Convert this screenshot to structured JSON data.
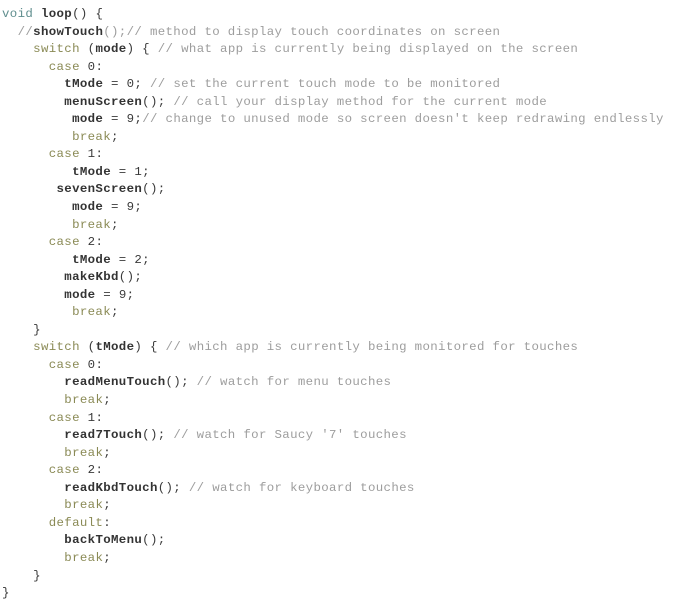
{
  "document": {
    "kind": "source-code-listing",
    "language": "Arduino C++",
    "background_color": "#ffffff",
    "theme": {
      "type_color": "#5f8e8e",
      "keyword_color": "#8a8a55",
      "function_color": "#333333",
      "comment_color": "#9d9d9d",
      "plain_color": "#3a3a3a"
    }
  },
  "code": {
    "lines": [
      {
        "indent": "",
        "tokens": [
          {
            "t": "type",
            "v": "void"
          },
          {
            "t": "plain",
            "v": " "
          },
          {
            "t": "func",
            "v": "loop"
          },
          {
            "t": "punct",
            "v": "() {"
          }
        ]
      },
      {
        "indent": "  ",
        "tokens": [
          {
            "t": "comment",
            "v": "//"
          },
          {
            "t": "func",
            "v": "showTouch"
          },
          {
            "t": "comment",
            "v": "();// method to display touch coordinates on screen"
          }
        ]
      },
      {
        "indent": "    ",
        "tokens": [
          {
            "t": "keyword",
            "v": "switch"
          },
          {
            "t": "plain",
            "v": " ("
          },
          {
            "t": "func",
            "v": "mode"
          },
          {
            "t": "plain",
            "v": ") { "
          },
          {
            "t": "comment",
            "v": "// what app is currently being displayed on the screen"
          }
        ]
      },
      {
        "indent": "      ",
        "tokens": [
          {
            "t": "keyword",
            "v": "case"
          },
          {
            "t": "plain",
            "v": " "
          },
          {
            "t": "number",
            "v": "0"
          },
          {
            "t": "punct",
            "v": ":"
          }
        ]
      },
      {
        "indent": "        ",
        "tokens": [
          {
            "t": "func",
            "v": "tMode"
          },
          {
            "t": "plain",
            "v": " = "
          },
          {
            "t": "number",
            "v": "0"
          },
          {
            "t": "punct",
            "v": "; "
          },
          {
            "t": "comment",
            "v": "// set the current touch mode to be monitored"
          }
        ]
      },
      {
        "indent": "        ",
        "tokens": [
          {
            "t": "func",
            "v": "menuScreen"
          },
          {
            "t": "punct",
            "v": "(); "
          },
          {
            "t": "comment",
            "v": "// call your display method for the current mode"
          }
        ]
      },
      {
        "indent": "         ",
        "tokens": [
          {
            "t": "func",
            "v": "mode"
          },
          {
            "t": "plain",
            "v": " = "
          },
          {
            "t": "number",
            "v": "9"
          },
          {
            "t": "punct",
            "v": ";"
          },
          {
            "t": "comment",
            "v": "// change to unused mode so screen doesn't keep redrawing endlessly"
          }
        ]
      },
      {
        "indent": "         ",
        "tokens": [
          {
            "t": "keyword",
            "v": "break"
          },
          {
            "t": "punct",
            "v": ";"
          }
        ]
      },
      {
        "indent": "      ",
        "tokens": [
          {
            "t": "keyword",
            "v": "case"
          },
          {
            "t": "plain",
            "v": " "
          },
          {
            "t": "number",
            "v": "1"
          },
          {
            "t": "punct",
            "v": ":"
          }
        ]
      },
      {
        "indent": "         ",
        "tokens": [
          {
            "t": "func",
            "v": "tMode"
          },
          {
            "t": "plain",
            "v": " = "
          },
          {
            "t": "number",
            "v": "1"
          },
          {
            "t": "punct",
            "v": ";"
          }
        ]
      },
      {
        "indent": "       ",
        "tokens": [
          {
            "t": "func",
            "v": "sevenScreen"
          },
          {
            "t": "punct",
            "v": "();"
          }
        ]
      },
      {
        "indent": "         ",
        "tokens": [
          {
            "t": "func",
            "v": "mode"
          },
          {
            "t": "plain",
            "v": " = "
          },
          {
            "t": "number",
            "v": "9"
          },
          {
            "t": "punct",
            "v": ";"
          }
        ]
      },
      {
        "indent": "         ",
        "tokens": [
          {
            "t": "keyword",
            "v": "break"
          },
          {
            "t": "punct",
            "v": ";"
          }
        ]
      },
      {
        "indent": "      ",
        "tokens": [
          {
            "t": "keyword",
            "v": "case"
          },
          {
            "t": "plain",
            "v": " "
          },
          {
            "t": "number",
            "v": "2"
          },
          {
            "t": "punct",
            "v": ":"
          }
        ]
      },
      {
        "indent": "         ",
        "tokens": [
          {
            "t": "func",
            "v": "tMode"
          },
          {
            "t": "plain",
            "v": " = "
          },
          {
            "t": "number",
            "v": "2"
          },
          {
            "t": "punct",
            "v": ";"
          }
        ]
      },
      {
        "indent": "        ",
        "tokens": [
          {
            "t": "func",
            "v": "makeKbd"
          },
          {
            "t": "punct",
            "v": "();"
          }
        ]
      },
      {
        "indent": "        ",
        "tokens": [
          {
            "t": "func",
            "v": "mode"
          },
          {
            "t": "plain",
            "v": " = "
          },
          {
            "t": "number",
            "v": "9"
          },
          {
            "t": "punct",
            "v": ";"
          }
        ]
      },
      {
        "indent": "         ",
        "tokens": [
          {
            "t": "keyword",
            "v": "break"
          },
          {
            "t": "punct",
            "v": ";"
          }
        ]
      },
      {
        "indent": "    ",
        "tokens": [
          {
            "t": "punct",
            "v": "}"
          }
        ]
      },
      {
        "indent": "    ",
        "tokens": [
          {
            "t": "keyword",
            "v": "switch"
          },
          {
            "t": "plain",
            "v": " ("
          },
          {
            "t": "func",
            "v": "tMode"
          },
          {
            "t": "plain",
            "v": ") { "
          },
          {
            "t": "comment",
            "v": "// which app is currently being monitored for touches"
          }
        ]
      },
      {
        "indent": "      ",
        "tokens": [
          {
            "t": "keyword",
            "v": "case"
          },
          {
            "t": "plain",
            "v": " "
          },
          {
            "t": "number",
            "v": "0"
          },
          {
            "t": "punct",
            "v": ":"
          }
        ]
      },
      {
        "indent": "        ",
        "tokens": [
          {
            "t": "func",
            "v": "readMenuTouch"
          },
          {
            "t": "punct",
            "v": "(); "
          },
          {
            "t": "comment",
            "v": "// watch for menu touches"
          }
        ]
      },
      {
        "indent": "        ",
        "tokens": [
          {
            "t": "keyword",
            "v": "break"
          },
          {
            "t": "punct",
            "v": ";"
          }
        ]
      },
      {
        "indent": "      ",
        "tokens": [
          {
            "t": "keyword",
            "v": "case"
          },
          {
            "t": "plain",
            "v": " "
          },
          {
            "t": "number",
            "v": "1"
          },
          {
            "t": "punct",
            "v": ":"
          }
        ]
      },
      {
        "indent": "        ",
        "tokens": [
          {
            "t": "func",
            "v": "read7Touch"
          },
          {
            "t": "punct",
            "v": "(); "
          },
          {
            "t": "comment",
            "v": "// watch for Saucy '7' touches"
          }
        ]
      },
      {
        "indent": "        ",
        "tokens": [
          {
            "t": "keyword",
            "v": "break"
          },
          {
            "t": "punct",
            "v": ";"
          }
        ]
      },
      {
        "indent": "      ",
        "tokens": [
          {
            "t": "keyword",
            "v": "case"
          },
          {
            "t": "plain",
            "v": " "
          },
          {
            "t": "number",
            "v": "2"
          },
          {
            "t": "punct",
            "v": ":"
          }
        ]
      },
      {
        "indent": "        ",
        "tokens": [
          {
            "t": "func",
            "v": "readKbdTouch"
          },
          {
            "t": "punct",
            "v": "(); "
          },
          {
            "t": "comment",
            "v": "// watch for keyboard touches"
          }
        ]
      },
      {
        "indent": "        ",
        "tokens": [
          {
            "t": "keyword",
            "v": "break"
          },
          {
            "t": "punct",
            "v": ";"
          }
        ]
      },
      {
        "indent": "      ",
        "tokens": [
          {
            "t": "keyword",
            "v": "default"
          },
          {
            "t": "punct",
            "v": ":"
          }
        ]
      },
      {
        "indent": "        ",
        "tokens": [
          {
            "t": "func",
            "v": "backToMenu"
          },
          {
            "t": "punct",
            "v": "();"
          }
        ]
      },
      {
        "indent": "        ",
        "tokens": [
          {
            "t": "keyword",
            "v": "break"
          },
          {
            "t": "punct",
            "v": ";"
          }
        ]
      },
      {
        "indent": "    ",
        "tokens": [
          {
            "t": "punct",
            "v": "}"
          }
        ]
      },
      {
        "indent": "",
        "tokens": [
          {
            "t": "punct",
            "v": "}"
          }
        ]
      }
    ]
  }
}
